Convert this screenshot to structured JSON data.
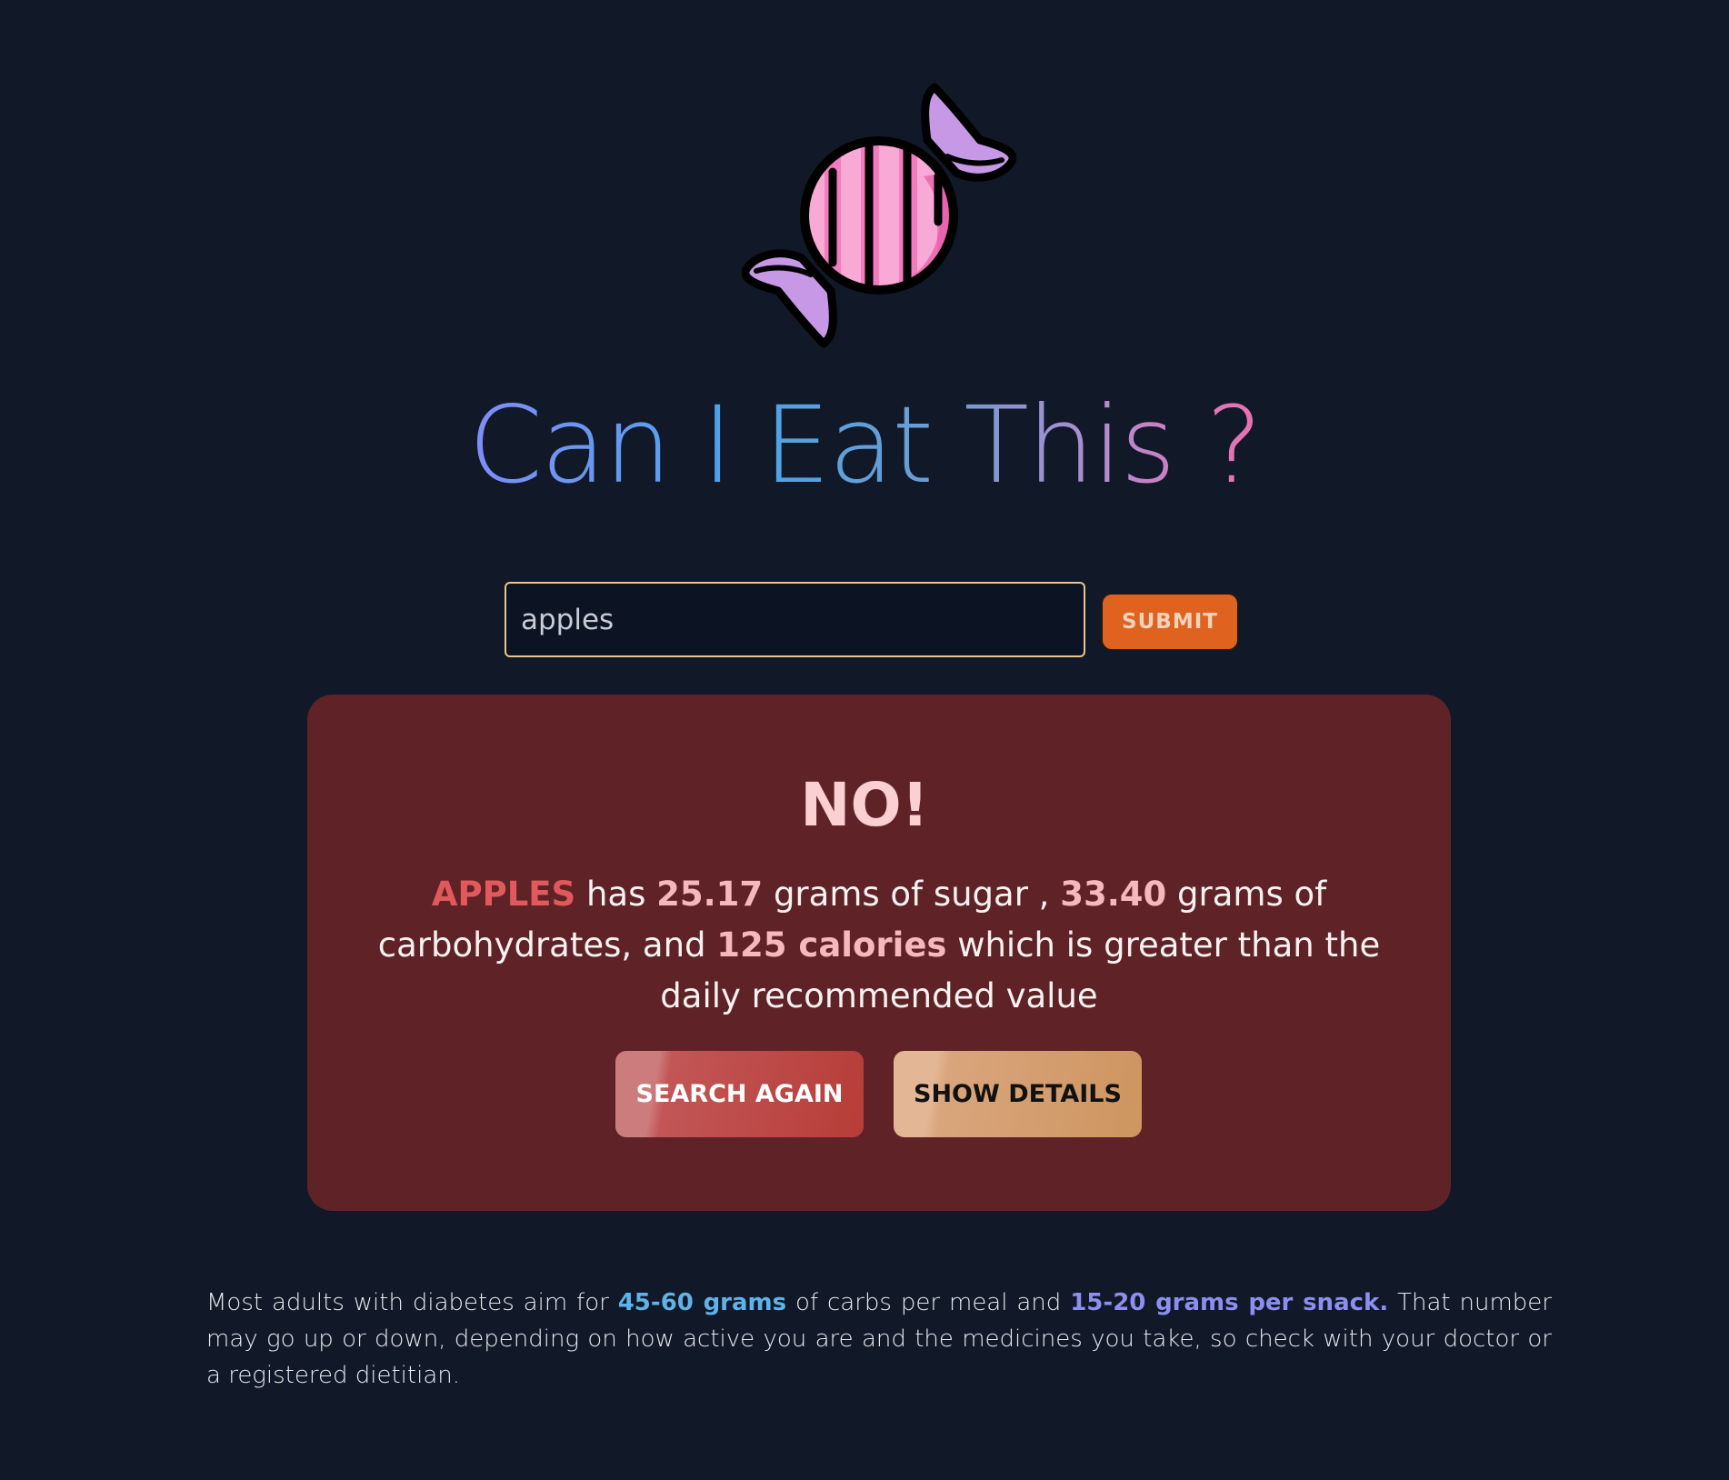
{
  "logo": {
    "icon": "candy-icon"
  },
  "title": "Can I Eat This ?",
  "search": {
    "value": "apples",
    "submit_label": "SUBMIT"
  },
  "result": {
    "verdict": "NO!",
    "food": "APPLES",
    "text_has": " has ",
    "sugar": "25.17",
    "text_sugar": " grams of sugar , ",
    "carbs": "33.40",
    "text_carbs": " grams of carbohydrates, and ",
    "calories": "125 calories",
    "text_end": " which is greater than the daily recommended value",
    "search_again_label": "SEARCH AGAIN",
    "show_details_label": "SHOW DETAILS"
  },
  "footnote": {
    "part1": "Most adults with diabetes aim for ",
    "highlight1": "45-60 grams",
    "part2": " of carbs per meal and ",
    "highlight2": "15-20 grams per snack.",
    "part3": " That number may go up or down, depending on how active you are and the medicines you take, so check with your doctor or a registered dietitian."
  },
  "colors": {
    "background": "#111827",
    "card": "#5f2327",
    "submit": "#e0621f",
    "input_border": "#e8c58a"
  }
}
